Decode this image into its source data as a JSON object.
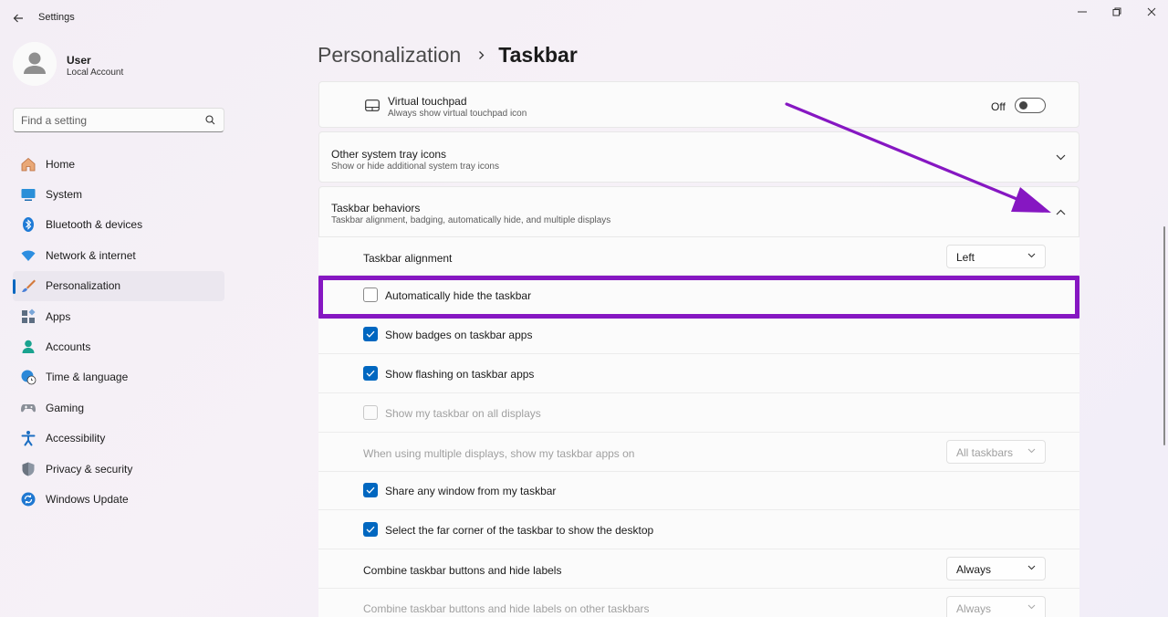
{
  "window": {
    "title": "Settings"
  },
  "user": {
    "name": "User",
    "account_type": "Local Account"
  },
  "search": {
    "placeholder": "Find a setting"
  },
  "nav": {
    "items": [
      {
        "label": "Home",
        "icon": "home-icon"
      },
      {
        "label": "System",
        "icon": "monitor-icon"
      },
      {
        "label": "Bluetooth & devices",
        "icon": "bluetooth-icon"
      },
      {
        "label": "Network & internet",
        "icon": "wifi-icon"
      },
      {
        "label": "Personalization",
        "icon": "brush-icon",
        "selected": true
      },
      {
        "label": "Apps",
        "icon": "apps-icon"
      },
      {
        "label": "Accounts",
        "icon": "person-icon"
      },
      {
        "label": "Time & language",
        "icon": "globe-clock-icon"
      },
      {
        "label": "Gaming",
        "icon": "gamepad-icon"
      },
      {
        "label": "Accessibility",
        "icon": "accessibility-icon"
      },
      {
        "label": "Privacy & security",
        "icon": "shield-icon"
      },
      {
        "label": "Windows Update",
        "icon": "update-icon"
      }
    ]
  },
  "breadcrumb": {
    "parent": "Personalization",
    "separator": "›",
    "current": "Taskbar"
  },
  "virtual_touchpad": {
    "title": "Virtual touchpad",
    "subtitle": "Always show virtual touchpad icon",
    "state": "Off"
  },
  "tray_icons": {
    "title": "Other system tray icons",
    "subtitle": "Show or hide additional system tray icons"
  },
  "behaviors": {
    "title": "Taskbar behaviors",
    "subtitle": "Taskbar alignment, badging, automatically hide, and multiple displays",
    "alignment": {
      "label": "Taskbar alignment",
      "value": "Left"
    },
    "auto_hide": {
      "label": "Automatically hide the taskbar",
      "checked": false
    },
    "badges": {
      "label": "Show badges on taskbar apps",
      "checked": true
    },
    "flashing": {
      "label": "Show flashing on taskbar apps",
      "checked": true
    },
    "all_displays": {
      "label": "Show my taskbar on all displays",
      "checked": false,
      "disabled": true
    },
    "multi_display": {
      "label": "When using multiple displays, show my taskbar apps on",
      "value": "All taskbars",
      "disabled": true
    },
    "share_window": {
      "label": "Share any window from my taskbar",
      "checked": true
    },
    "far_corner": {
      "label": "Select the far corner of the taskbar to show the desktop",
      "checked": true
    },
    "combine": {
      "label": "Combine taskbar buttons and hide labels",
      "value": "Always"
    },
    "combine_other": {
      "label": "Combine taskbar buttons and hide labels on other taskbars",
      "value": "Always",
      "disabled": true
    }
  },
  "colors": {
    "accent": "#0067c0",
    "annotation": "#8617c2"
  }
}
